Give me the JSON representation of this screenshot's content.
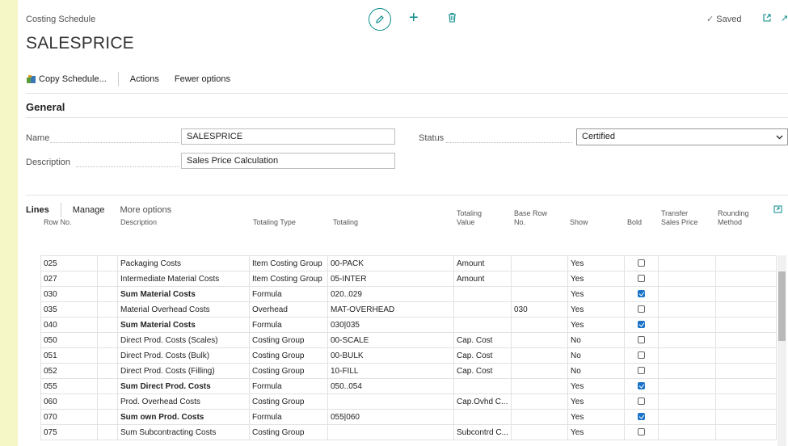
{
  "header": {
    "breadcrumb": "Costing Schedule",
    "title": "SALESPRICE",
    "saved_label": "Saved",
    "saved_check": "✓"
  },
  "actions": {
    "copy_schedule": "Copy Schedule...",
    "actions": "Actions",
    "fewer_options": "Fewer options"
  },
  "general": {
    "section_title": "General",
    "name_label": "Name",
    "name_value": "SALESPRICE",
    "description_label": "Description",
    "description_value": "Sales Price Calculation",
    "status_label": "Status",
    "status_value": "Certified"
  },
  "lines": {
    "title": "Lines",
    "manage": "Manage",
    "more_options": "More options",
    "columns": {
      "row_no": "Row No.",
      "description": "Description",
      "totaling_type": "Totaling Type",
      "totaling": "Totaling",
      "totaling_value": "Totaling Value",
      "base_row_no": "Base Row No.",
      "show": "Show",
      "bold": "Bold",
      "transfer_sales_price": "Transfer Sales Price",
      "rounding_method": "Rounding Method"
    },
    "rows": [
      {
        "row_no": "025",
        "description": "Packaging Costs",
        "totaling_type": "Item Costing Group",
        "totaling": "00-PACK",
        "totaling_value": "Amount",
        "base_row_no": "",
        "show": "Yes",
        "bold": false
      },
      {
        "row_no": "027",
        "description": "Intermediate Material Costs",
        "totaling_type": "Item Costing Group",
        "totaling": "05-INTER",
        "totaling_value": "Amount",
        "base_row_no": "",
        "show": "Yes",
        "bold": false
      },
      {
        "row_no": "030",
        "description": "Sum Material Costs",
        "totaling_type": "Formula",
        "totaling": "020..029",
        "totaling_value": "",
        "base_row_no": "",
        "show": "Yes",
        "bold": true
      },
      {
        "row_no": "035",
        "description": "Material Overhead Costs",
        "totaling_type": "Overhead",
        "totaling": "MAT-OVERHEAD",
        "totaling_value": "",
        "base_row_no": "030",
        "show": "Yes",
        "bold": false
      },
      {
        "row_no": "040",
        "description": "Sum Material Costs",
        "totaling_type": "Formula",
        "totaling": "030|035",
        "totaling_value": "",
        "base_row_no": "",
        "show": "Yes",
        "bold": true
      },
      {
        "row_no": "050",
        "description": "Direct Prod. Costs (Scales)",
        "totaling_type": "Costing Group",
        "totaling": "00-SCALE",
        "totaling_value": "Cap. Cost",
        "base_row_no": "",
        "show": "No",
        "bold": false
      },
      {
        "row_no": "051",
        "description": "Direct Prod. Costs (Bulk)",
        "totaling_type": "Costing Group",
        "totaling": "00-BULK",
        "totaling_value": "Cap. Cost",
        "base_row_no": "",
        "show": "No",
        "bold": false
      },
      {
        "row_no": "052",
        "description": "Direct Prod. Costs (Filling)",
        "totaling_type": "Costing Group",
        "totaling": "10-FILL",
        "totaling_value": "Cap. Cost",
        "base_row_no": "",
        "show": "No",
        "bold": false
      },
      {
        "row_no": "055",
        "description": "Sum Direct Prod. Costs",
        "totaling_type": "Formula",
        "totaling": "050..054",
        "totaling_value": "",
        "base_row_no": "",
        "show": "Yes",
        "bold": true
      },
      {
        "row_no": "060",
        "description": "Prod. Overhead Costs",
        "totaling_type": "Costing Group",
        "totaling": "",
        "totaling_value": "Cap.Ovhd C...",
        "base_row_no": "",
        "show": "Yes",
        "bold": false
      },
      {
        "row_no": "070",
        "description": "Sum own Prod. Costs",
        "totaling_type": "Formula",
        "totaling": "055|060",
        "totaling_value": "",
        "base_row_no": "",
        "show": "Yes",
        "bold": true
      },
      {
        "row_no": "075",
        "description": "Sum Subcontracting Costs",
        "totaling_type": "Costing Group",
        "totaling": "",
        "totaling_value": "Subcontrd C...",
        "base_row_no": "",
        "show": "Yes",
        "bold": false
      }
    ]
  },
  "colors": {
    "accent": "#0a8a8a",
    "checkbox_on": "#1a73c8"
  },
  "icons": [
    "edit-icon",
    "add-icon",
    "delete-icon",
    "copy-schedule-icon",
    "popout-icon",
    "pin-icon",
    "expand-icon",
    "chevron-down-icon"
  ]
}
